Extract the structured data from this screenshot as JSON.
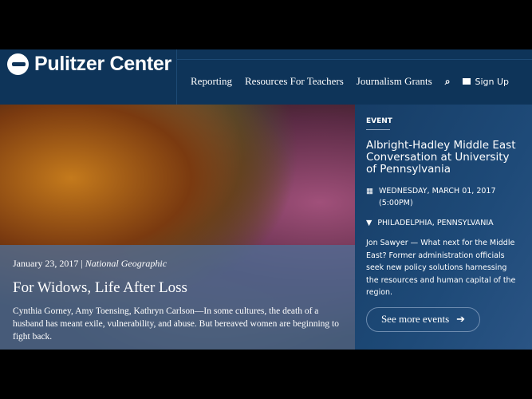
{
  "header": {
    "brand": "Pulitzer Center",
    "nav": [
      "Reporting",
      "Resources For Teachers",
      "Journalism Grants"
    ],
    "signup": "Sign Up"
  },
  "feature": {
    "date": "January 23, 2017",
    "separator": "|",
    "source": "National Geographic",
    "title": "For Widows, Life After Loss",
    "summary": "Cynthia Gorney, Amy Toensing, Kathryn Carlson—In some cultures, the death of a husband has meant exile, vulnerability, and abuse. But bereaved women are beginning to fight back."
  },
  "event": {
    "label": "EVENT",
    "title": "Albright-Hadley Middle East Conversation at University of Pennsylvania",
    "datetime": "WEDNESDAY, MARCH 01, 2017 (5:00PM)",
    "location": "PHILADELPHIA, PENNSYLVANIA",
    "description": "Jon Sawyer — What next for the Middle East? Former administration officials seek new policy solutions harnessing the resources and human capital of the region.",
    "button": "See more events"
  }
}
